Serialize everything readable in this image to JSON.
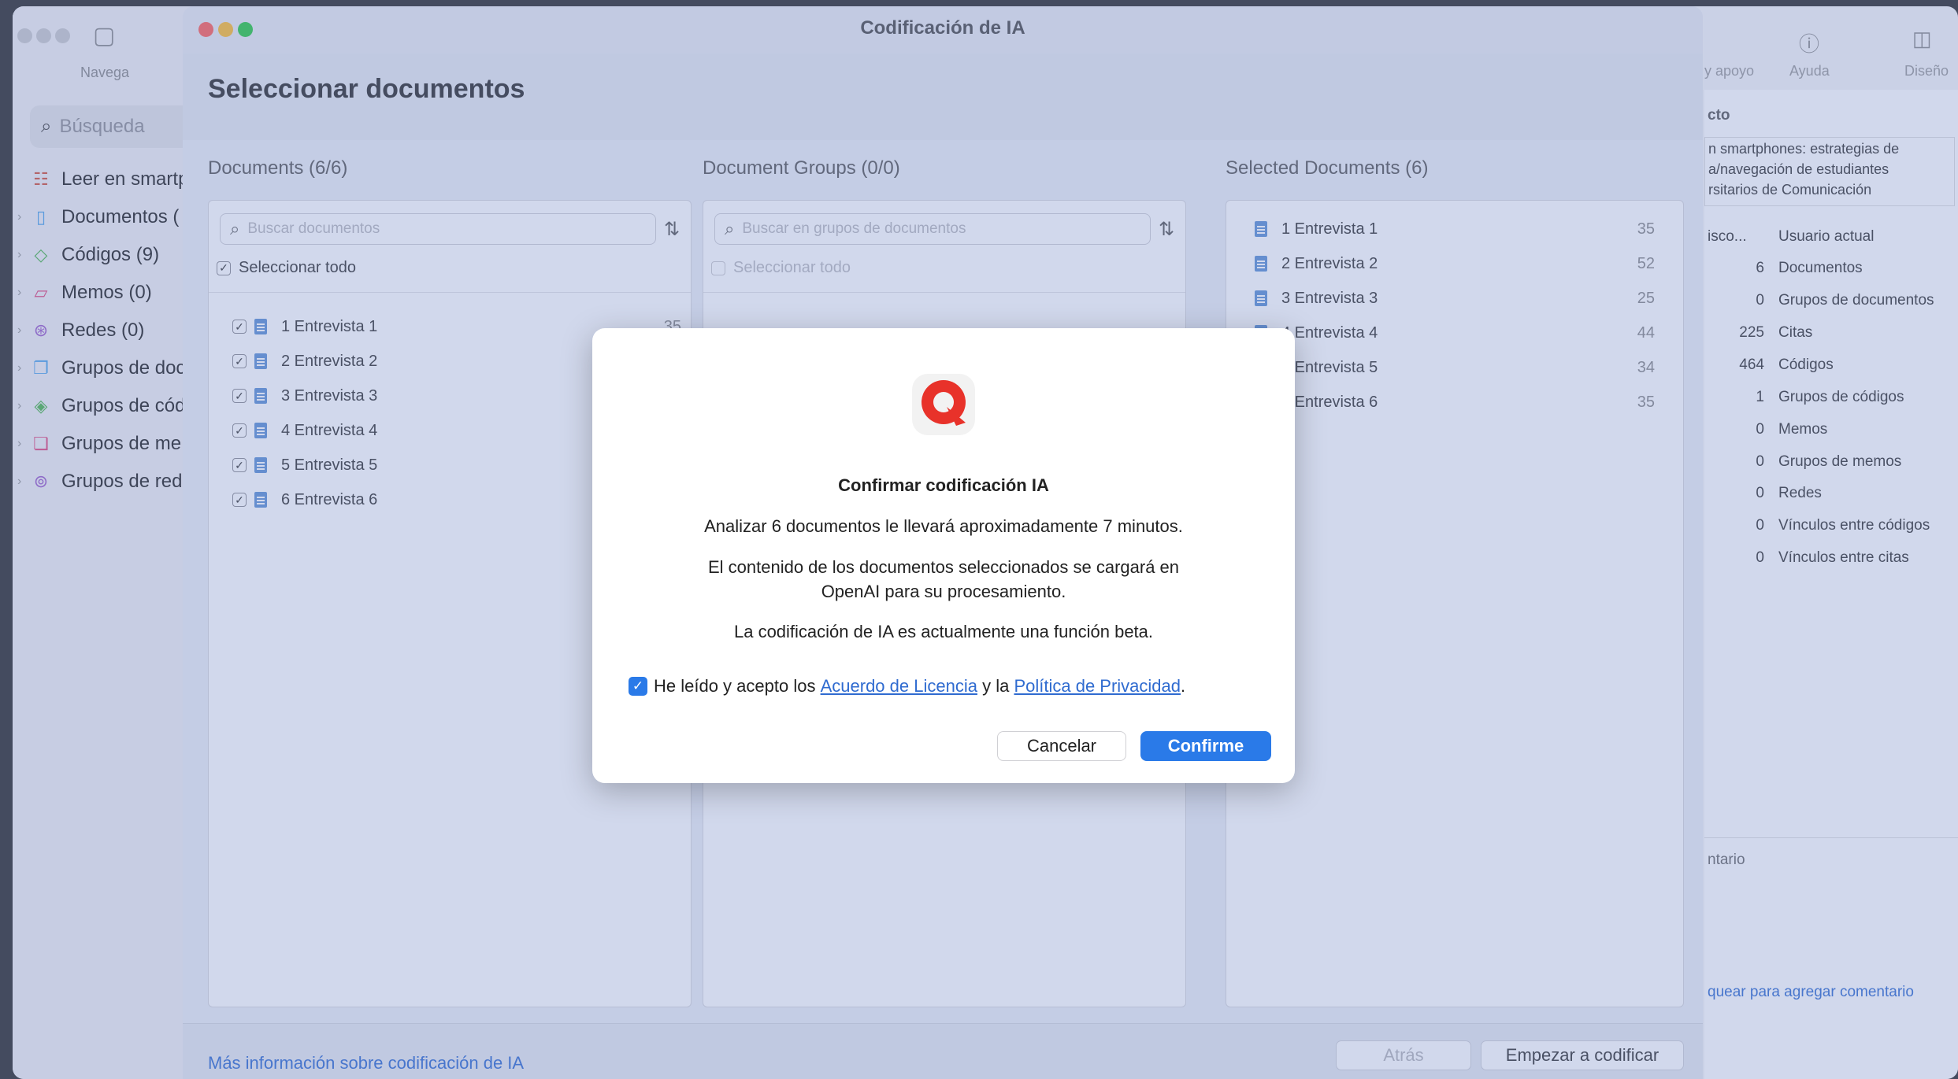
{
  "background_app": {
    "toolbar": {
      "navigate_label": "Navega",
      "support_label": "y apoyo",
      "help_label": "Ayuda",
      "design_label": "Diseño"
    },
    "search": {
      "placeholder": "Búsqueda"
    },
    "sidebar": {
      "items": [
        {
          "label": "Leer en smartp",
          "icon": "reader-icon"
        },
        {
          "label": "Documentos (",
          "icon": "document-icon"
        },
        {
          "label": "Códigos (9)",
          "icon": "code-icon"
        },
        {
          "label": "Memos (0)",
          "icon": "memo-icon"
        },
        {
          "label": "Redes (0)",
          "icon": "network-icon"
        },
        {
          "label": "Grupos de doc",
          "icon": "document-group-icon"
        },
        {
          "label": "Grupos de cód",
          "icon": "code-group-icon"
        },
        {
          "label": "Grupos de me",
          "icon": "memo-group-icon"
        },
        {
          "label": "Grupos de red",
          "icon": "network-group-icon"
        }
      ]
    },
    "inspector": {
      "section_title": "cto",
      "project_description": [
        "n smartphones: estrategias de",
        "a/navegación de estudiantes",
        "rsitarios de Comunicación"
      ],
      "user_prefix": "isco...",
      "user_label": "Usuario actual",
      "stats": [
        {
          "value": "6",
          "label": "Documentos"
        },
        {
          "value": "0",
          "label": "Grupos de documentos"
        },
        {
          "value": "225",
          "label": "Citas"
        },
        {
          "value": "464",
          "label": "Códigos"
        },
        {
          "value": "1",
          "label": "Grupos de códigos"
        },
        {
          "value": "0",
          "label": "Memos"
        },
        {
          "value": "0",
          "label": "Grupos de memos"
        },
        {
          "value": "0",
          "label": "Redes"
        },
        {
          "value": "0",
          "label": "Vínculos entre códigos"
        },
        {
          "value": "0",
          "label": "Vínculos entre citas"
        }
      ],
      "comment_title": "ntario",
      "comment_hint": "quear para agregar comentario"
    }
  },
  "ai_window": {
    "title": "Codificación de IA",
    "heading": "Seleccionar documentos",
    "documents": {
      "title": "Documents (6/6)",
      "search_placeholder": "Buscar documentos",
      "select_all": "Seleccionar todo",
      "rows": [
        {
          "label": "1 Entrevista 1",
          "count": "35"
        },
        {
          "label": "2 Entrevista 2",
          "count": ""
        },
        {
          "label": "3 Entrevista 3",
          "count": ""
        },
        {
          "label": "4 Entrevista 4",
          "count": ""
        },
        {
          "label": "5 Entrevista 5",
          "count": ""
        },
        {
          "label": "6 Entrevista 6",
          "count": ""
        }
      ]
    },
    "document_groups": {
      "title": "Document Groups (0/0)",
      "search_placeholder": "Buscar en grupos de documentos",
      "select_all": "Seleccionar todo"
    },
    "selected_documents": {
      "title": "Selected Documents (6)",
      "rows": [
        {
          "label": "1 Entrevista 1",
          "count": "35"
        },
        {
          "label": "2 Entrevista 2",
          "count": "52"
        },
        {
          "label": "3 Entrevista 3",
          "count": "25"
        },
        {
          "label": "4 Entrevista 4",
          "count": "44"
        },
        {
          "label": "5 Entrevista 5",
          "count": "34"
        },
        {
          "label": "6 Entrevista 6",
          "count": "35"
        }
      ]
    },
    "footer": {
      "more_info": "Más información sobre codificación de IA",
      "back_label": "Atrás",
      "start_label": "Empezar a codificar"
    }
  },
  "dialog": {
    "title": "Confirmar codificación IA",
    "line1": "Analizar 6 documentos le llevará aproximadamente 7 minutos.",
    "line2a": "El contenido de los documentos seleccionados se cargará en",
    "line2b": "OpenAI para su procesamiento.",
    "line3": "La codificación de IA es actualmente una función beta.",
    "agree_prefix": "He leído y acepto los",
    "license_link": "Acuerdo de Licencia",
    "agree_middle": "y la",
    "privacy_link": "Política de Privacidad",
    "agree_suffix": ".",
    "agree_checked": true,
    "cancel_label": "Cancelar",
    "confirm_label": "Confirme"
  },
  "colors": {
    "accent": "#2a7ae8",
    "logo_red": "#e8322a",
    "link": "#2f6bd0"
  }
}
